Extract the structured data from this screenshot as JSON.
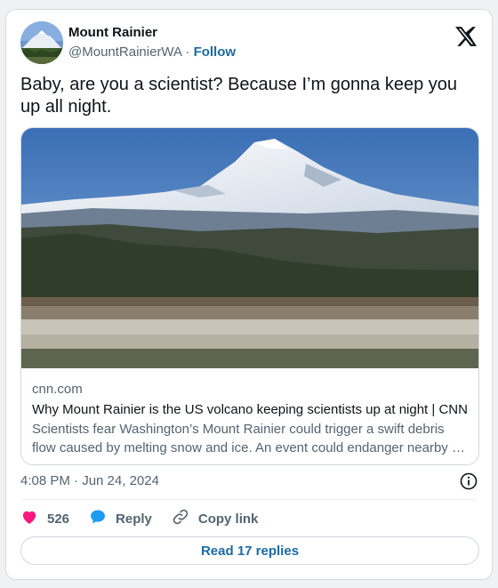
{
  "author": {
    "display_name": "Mount Rainier",
    "handle": "@MountRainierWA",
    "separator": "·",
    "follow_label": "Follow"
  },
  "tweet": {
    "text": "Baby, are you a scientist? Because I’m gonna keep you up all night."
  },
  "link_card": {
    "domain": "cnn.com",
    "title": "Why Mount Rainier is the US volcano keeping scientists up at night | CNN",
    "description": "Scientists fear Washington’s Mount Rainier could trigger a swift debris flow caused by melting snow and ice. An event could endanger nearby …"
  },
  "meta": {
    "timestamp": "4:08 PM · Jun 24, 2024"
  },
  "actions": {
    "like_count": "526",
    "reply_label": "Reply",
    "copy_link_label": "Copy link"
  },
  "footer": {
    "read_replies_label": "Read 17 replies"
  },
  "colors": {
    "accent": "#1d6aa3",
    "like": "#f91880",
    "reply": "#1d9bf0",
    "muted_text": "#536471"
  },
  "icons": {
    "brand": "x-logo-icon",
    "info": "info-icon",
    "like": "heart-icon",
    "reply": "speech-bubble-icon",
    "copy": "link-icon"
  }
}
